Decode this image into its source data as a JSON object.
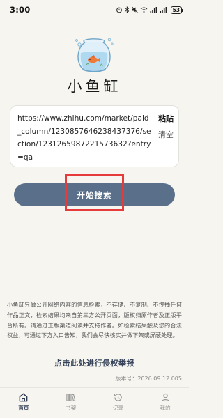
{
  "status_bar": {
    "time": "3:00",
    "battery": "53"
  },
  "app": {
    "name": "小鱼缸"
  },
  "search": {
    "url_value": "https://www.zhihu.com/market/paid_column/1230857646238437376/section/1231265987221573632?entry=qa",
    "paste_label": "粘贴",
    "clear_label": "清空",
    "button_label": "开始搜索"
  },
  "disclaimer": {
    "text": "小鱼缸只做公开网络内容的信息检索，不存储、不复制、不传播任何作品正文，检索结果均来自第三方公开页面，版权归原作者及正版平台所有。请通过正版渠道阅读并支持作者。如检索结果触及您的合法权益，可通过下方入口告知，我们会尽快核实并做下架或屏蔽处理。",
    "report_link": "点击此处进行侵权举报",
    "version": "版本号：2026.09.12.005"
  },
  "tabs": [
    {
      "label": "首页",
      "icon": "home-icon",
      "active": true
    },
    {
      "label": "书架",
      "icon": "bookshelf-icon",
      "active": false
    },
    {
      "label": "记录",
      "icon": "history-icon",
      "active": false
    },
    {
      "label": "我的",
      "icon": "profile-icon",
      "active": false
    }
  ],
  "colors": {
    "background": "#f6f5f0",
    "button": "#5a6f89",
    "highlight": "#e53b3b",
    "link": "#36435a"
  }
}
